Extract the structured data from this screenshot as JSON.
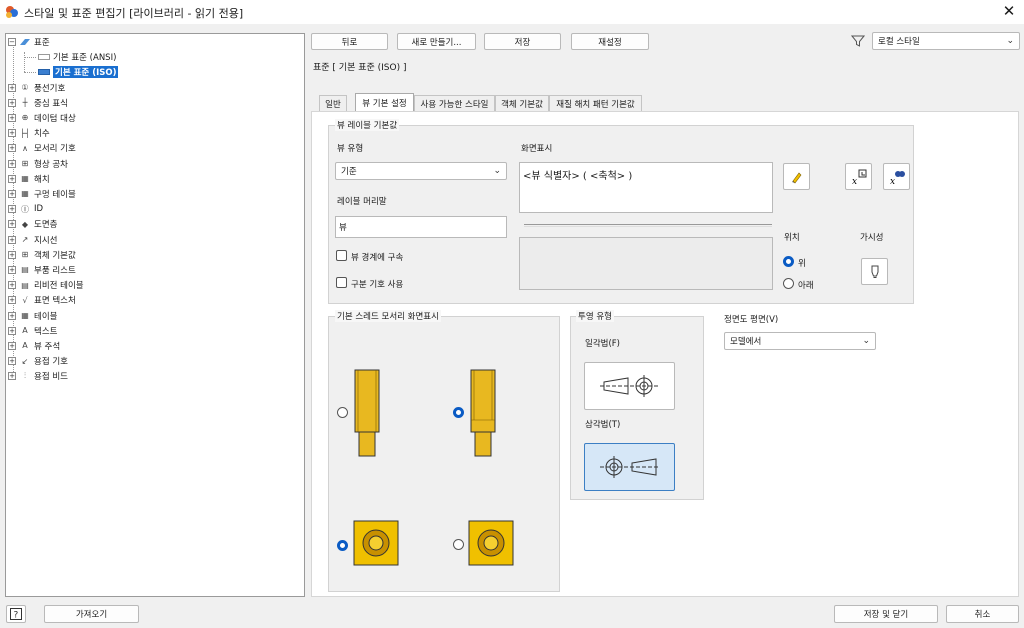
{
  "window": {
    "title": "스타일 및 표준 편집기 [라이브러리 - 읽기 전용]"
  },
  "tree": {
    "root": "표준",
    "standards": [
      "기본 표준 (ANSI)",
      "기본 표준 (ISO)"
    ],
    "categories": [
      "풍선기호",
      "중심 표식",
      "데이텀 대상",
      "치수",
      "모서리 기호",
      "형상 공차",
      "해치",
      "구멍 테이블",
      "ID",
      "도면층",
      "지시선",
      "객체 기본값",
      "부품 리스트",
      "리비전 테이블",
      "표면 텍스처",
      "테이블",
      "텍스트",
      "뷰 주석",
      "용접 기호",
      "용접 비드"
    ]
  },
  "toolbar": {
    "back": "뒤로",
    "new": "새로 만들기...",
    "save": "저장",
    "reset": "재설정",
    "filter_value": "로컬 스타일"
  },
  "header": {
    "standard_label": "표준 [ 기본 표준 (ISO) ]"
  },
  "tabs": [
    "일반",
    "뷰 기본 설정",
    "사용 가능한 스타일",
    "객체 기본값",
    "재질 해치 패턴 기본값"
  ],
  "view_label": {
    "group_title": "뷰 레이블 기본값",
    "view_type_label": "뷰 유형",
    "view_type_value": "기준",
    "display_label": "화면표시",
    "display_value": "<뷰 식별자> ( <축척> )",
    "prefix_label": "레이블 머리말",
    "prefix_value": "뷰",
    "constrain_label": "뷰 경계에 구속",
    "delimiter_label": "구분 기호 사용",
    "position_label": "위치",
    "pos_above": "위",
    "pos_below": "아래",
    "visibility_label": "가시성"
  },
  "thread": {
    "group_title": "기본 스레드 모서리 화면표시"
  },
  "projection": {
    "group_title": "투영 유형",
    "first_angle": "일각법(F)",
    "third_angle": "삼각법(T)"
  },
  "front_plane": {
    "label": "정면도 평면(V)",
    "value": "모델에서"
  },
  "bottom": {
    "import": "가져오기",
    "save_close": "저장 및 닫기",
    "cancel": "취소"
  }
}
